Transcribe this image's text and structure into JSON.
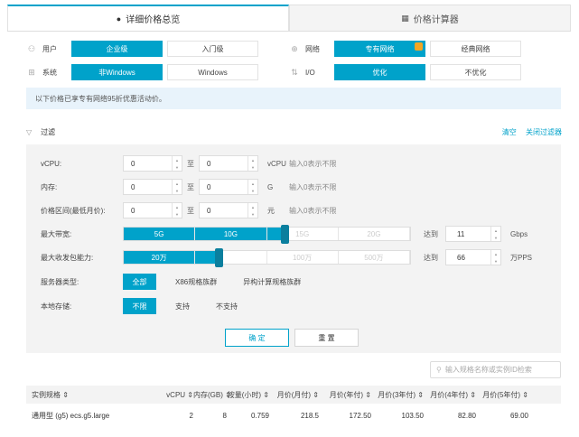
{
  "tabs": [
    {
      "label": "详细价格总览",
      "icon": "circle-icon"
    },
    {
      "label": "价格计算器",
      "icon": "calculator-icon"
    }
  ],
  "options": {
    "user": {
      "label": "用户",
      "values": [
        "企业级",
        "入门级"
      ],
      "selected": "企业级"
    },
    "network": {
      "label": "网络",
      "values": [
        "专有网络",
        "经典网络"
      ],
      "selected": "专有网络"
    },
    "system": {
      "label": "系统",
      "values": [
        "非Windows",
        "Windows"
      ],
      "selected": "非Windows"
    },
    "io": {
      "label": "I/O",
      "values": [
        "优化",
        "不优化"
      ],
      "selected": "优化"
    }
  },
  "notice": "以下价格已享专有网络95折优惠活动价。",
  "filter": {
    "title": "过滤",
    "clear": "清空",
    "close": "关闭过滤器",
    "vcpu": {
      "label": "vCPU:",
      "min": "0",
      "max": "0",
      "to": "至",
      "unit": "vCPU",
      "hint": "输入0表示不限"
    },
    "memory": {
      "label": "内存:",
      "min": "0",
      "max": "0",
      "to": "至",
      "unit": "G",
      "hint": "输入0表示不限"
    },
    "price": {
      "label": "价格区间(最低月价):",
      "min": "0",
      "max": "0",
      "to": "至",
      "unit": "元",
      "hint": "输入0表示不限"
    },
    "bandwidth": {
      "label": "最大带宽:",
      "ticks": [
        "5G",
        "10G",
        "15G",
        "20G"
      ],
      "level": 0.56,
      "reach": "达到",
      "value": "11",
      "unit": "Gbps"
    },
    "pps": {
      "label": "最大收发包能力:",
      "ticks": [
        "20万",
        "50万",
        "100万",
        "500万"
      ],
      "level": 0.33,
      "reach": "达到",
      "value": "66",
      "unit": "万PPS"
    },
    "server_type": {
      "label": "服务器类型:",
      "values": [
        "全部",
        "X86规格族群",
        "异构计算规格族群"
      ],
      "selected": "全部"
    },
    "local_storage": {
      "label": "本地存储:",
      "values": [
        "不限",
        "支持",
        "不支持"
      ],
      "selected": "不限"
    },
    "confirm": "确 定",
    "reset": "重 置"
  },
  "search": {
    "placeholder": "输入规格名称或实例ID检索"
  },
  "table": {
    "headers": [
      "实例规格 ⇕",
      "vCPU ⇕",
      "内存(GB) ⇕",
      "按量(小时) ⇕",
      "月价(月付) ⇕",
      "月价(年付) ⇕",
      "月价(3年付) ⇕",
      "月价(4年付) ⇕",
      "月价(5年付) ⇕"
    ],
    "rows": [
      [
        "通用型 (g5) ecs.g5.large",
        "2",
        "8",
        "0.759",
        "218.5",
        "172.50",
        "103.50",
        "82.80",
        "69.00"
      ]
    ]
  },
  "colors": {
    "accent": "#00a2ca",
    "panel": "#f3f3f3",
    "notice": "#e8f3fb"
  }
}
